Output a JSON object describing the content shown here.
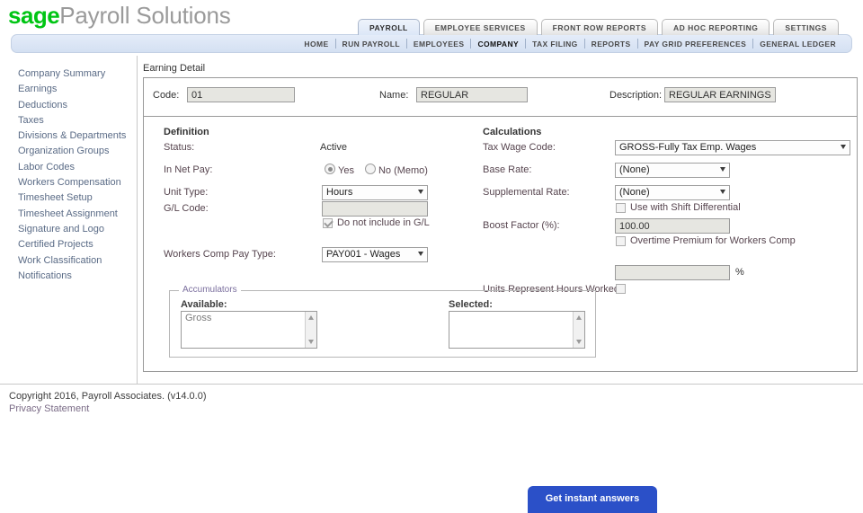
{
  "brand": {
    "logo_primary": "sage",
    "logo_secondary": "Payroll Solutions",
    "logo_color": "#00c514"
  },
  "tabs": [
    {
      "label": "PAYROLL",
      "active": true
    },
    {
      "label": "EMPLOYEE SERVICES",
      "active": false
    },
    {
      "label": "FRONT ROW REPORTS",
      "active": false
    },
    {
      "label": "AD HOC REPORTING",
      "active": false
    },
    {
      "label": "SETTINGS",
      "active": false
    }
  ],
  "subnav": [
    {
      "label": "HOME",
      "active": false
    },
    {
      "label": "RUN PAYROLL",
      "active": false
    },
    {
      "label": "EMPLOYEES",
      "active": false
    },
    {
      "label": "COMPANY",
      "active": true
    },
    {
      "label": "TAX FILING",
      "active": false
    },
    {
      "label": "REPORTS",
      "active": false
    },
    {
      "label": "PAY GRID PREFERENCES",
      "active": false
    },
    {
      "label": "GENERAL LEDGER",
      "active": false
    }
  ],
  "sidebar": {
    "items": [
      {
        "label": "Company Summary"
      },
      {
        "label": "Earnings"
      },
      {
        "label": "Deductions"
      },
      {
        "label": "Taxes"
      },
      {
        "label": "Divisions & Departments"
      },
      {
        "label": "Organization Groups"
      },
      {
        "label": "Labor Codes"
      },
      {
        "label": "Workers Compensation"
      },
      {
        "label": "Timesheet Setup"
      },
      {
        "label": "Timesheet Assignment"
      },
      {
        "label": "Signature and Logo"
      },
      {
        "label": "Certified Projects"
      },
      {
        "label": "Work Classification"
      },
      {
        "label": "Notifications"
      }
    ]
  },
  "content": {
    "title": "Earning Detail",
    "identity": {
      "code_label": "Code:",
      "code_value": "01",
      "name_label": "Name:",
      "name_value": "REGULAR",
      "description_label": "Description:",
      "description_value": "REGULAR EARNINGS"
    },
    "definition": {
      "section_title": "Definition",
      "status_label": "Status:",
      "status_value": "Active",
      "in_net_pay_label": "In Net Pay:",
      "in_net_pay_yes": "Yes",
      "in_net_pay_no": "No (Memo)",
      "unit_type_label": "Unit Type:",
      "unit_type_value": "Hours",
      "gl_code_label": "G/L Code:",
      "gl_code_value": "",
      "no_gl_label": "Do not include in G/L",
      "wc_pay_type_label": "Workers Comp Pay Type:",
      "wc_pay_type_value": "PAY001 - Wages"
    },
    "calculations": {
      "section_title": "Calculations",
      "tax_wage_code_label": "Tax Wage Code:",
      "tax_wage_code_value": "GROSS-Fully Tax Emp. Wages",
      "base_rate_label": "Base Rate:",
      "base_rate_value": "(None)",
      "supplemental_rate_label": "Supplemental Rate:",
      "supplemental_rate_value": "(None)",
      "shift_differential_label": "Use with Shift Differential",
      "boost_factor_label": "Boost Factor (%):",
      "boost_factor_value": "100.00",
      "overtime_premium_label": "Overtime Premium for Workers Comp",
      "percent_value": "",
      "percent_suffix": "%",
      "units_hours_label": "Units Represent Hours Worked:"
    },
    "accumulators": {
      "legend": "Accumulators",
      "available_label": "Available:",
      "available_items": [
        "Gross"
      ],
      "selected_label": "Selected:",
      "selected_items": []
    }
  },
  "footer": {
    "copyright": "Copyright 2016, Payroll Associates. (v14.0.0)",
    "privacy": "Privacy Statement"
  },
  "chat": {
    "label": "Get instant answers",
    "color": "#2b50c8"
  }
}
